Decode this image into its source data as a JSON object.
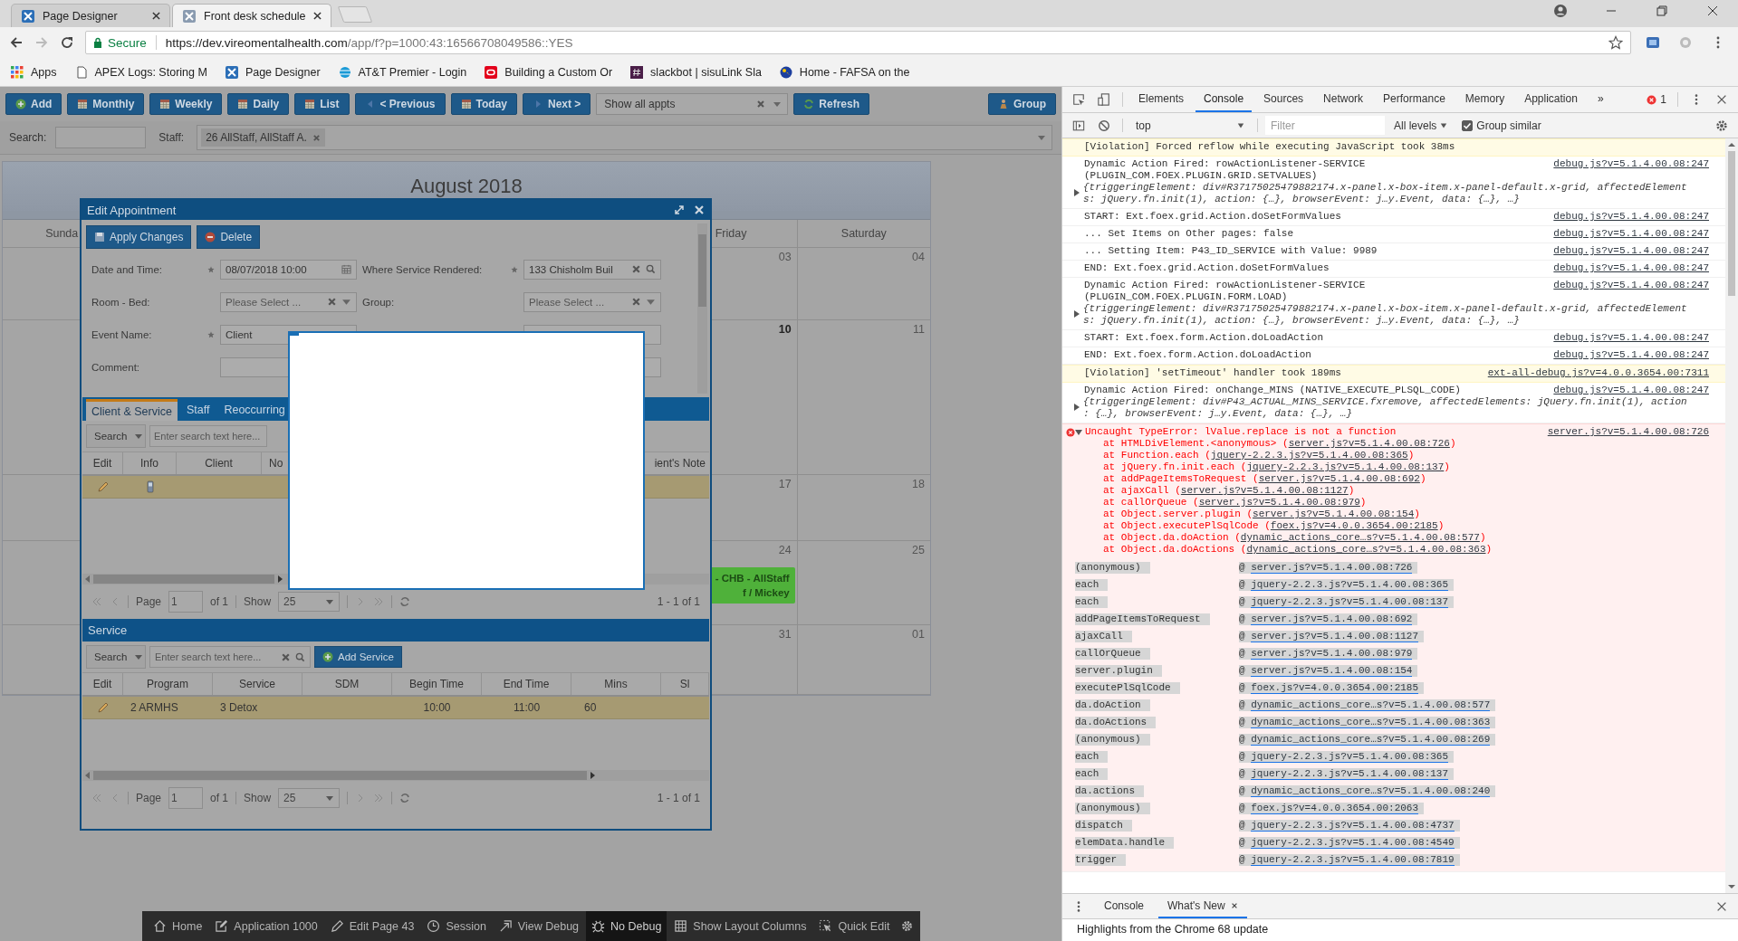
{
  "browser": {
    "tabs": [
      {
        "title": "Page Designer",
        "selected": false
      },
      {
        "title": "Front desk schedule",
        "selected": true
      }
    ],
    "address": {
      "secure_label": "Secure",
      "url_host": "https://dev.vireomentalhealth.com",
      "url_path": "/app/f?p=1000:43:16566708049586::YES"
    },
    "bookmarks": [
      {
        "label": "Apps",
        "kind": "apps"
      },
      {
        "label": "APEX Logs: Storing M",
        "kind": "page"
      },
      {
        "label": "Page Designer",
        "kind": "apex"
      },
      {
        "label": "AT&T Premier - Login",
        "kind": "globe"
      },
      {
        "label": "Building a Custom Or",
        "kind": "oracle"
      },
      {
        "label": "slackbot | sisuLink Sla",
        "kind": "hash"
      },
      {
        "label": "Home - FAFSA on the",
        "kind": "earth"
      }
    ]
  },
  "app": {
    "toolbar": [
      {
        "label": "Add",
        "kind": "add"
      },
      {
        "label": "Monthly",
        "kind": "calendar"
      },
      {
        "label": "Weekly",
        "kind": "calendar"
      },
      {
        "label": "Daily",
        "kind": "calendar"
      },
      {
        "label": "List",
        "kind": "calendar"
      },
      {
        "label": "< Previous",
        "kind": "prev"
      },
      {
        "label": "Today",
        "kind": "calendar"
      },
      {
        "label": "Next >",
        "kind": "next"
      }
    ],
    "filter_select": "Show all appts",
    "refresh": "Refresh",
    "group": "Group",
    "search_label": "Search:",
    "staff_label": "Staff:",
    "staff_chip": "26 AllStaff, AllStaff A.",
    "calendar": {
      "title": "August 2018",
      "weekdays": {
        "sunday": "Sunda",
        "friday": "Friday",
        "saturday": "Saturday"
      },
      "weeks": [
        {
          "friday": {
            "number": "03",
            "today": false
          },
          "saturday": {
            "number": "04",
            "today": false
          }
        },
        {
          "friday": {
            "number": "10",
            "today": true
          },
          "saturday": {
            "number": "11",
            "today": false
          }
        },
        {
          "friday": {
            "number": "17",
            "today": false
          },
          "saturday": {
            "number": "18",
            "today": false
          }
        },
        {
          "friday": {
            "number": "24",
            "today": false,
            "event": "- CHB - AllStaff\nf / Mickey"
          },
          "saturday": {
            "number": "25",
            "today": false
          }
        },
        {
          "friday": {
            "number": "31",
            "today": false
          },
          "saturday": {
            "number": "01",
            "today": false
          }
        }
      ]
    },
    "dialog": {
      "title": "Edit Appointment",
      "apply": "Apply Changes",
      "delete": "Delete",
      "form": [
        {
          "fields": [
            {
              "label": "Date and Time:",
              "required": true,
              "value": "08/07/2018 10:00",
              "kind": "date"
            },
            {
              "label": "Where Service Rendered:",
              "required": true,
              "value": "133 Chisholm Buil",
              "kind": "lookup"
            }
          ]
        },
        {
          "fields": [
            {
              "label": "Room - Bed:",
              "required": false,
              "placeholder": "Please Select ...",
              "kind": "select"
            },
            {
              "label": "Group:",
              "required": false,
              "placeholder": "Please Select ...",
              "kind": "select"
            }
          ]
        },
        {
          "fields": [
            {
              "label": "Event Name:",
              "required": true,
              "value": "Client",
              "kind": "text"
            },
            {
              "kind": "text"
            }
          ]
        },
        {
          "fields": [
            {
              "label": "Comment:",
              "required": false,
              "kind": "text"
            },
            {
              "kind": "text"
            }
          ]
        }
      ],
      "tabs": [
        {
          "label": "Client & Service",
          "selected": true
        },
        {
          "label": "Staff",
          "selected": false
        },
        {
          "label": "Reoccurring",
          "selected": false
        }
      ],
      "client_grid": {
        "search": "Search",
        "placeholder": "Enter search text here...",
        "columns": [
          "Edit",
          "Info",
          "Client",
          "No"
        ],
        "column_right": "ient's Note",
        "pager": {
          "page": "Page",
          "page_value": "1",
          "of": "of 1",
          "show": "Show",
          "show_value": "25",
          "count": "1 - 1 of 1"
        }
      },
      "service_title": "Service",
      "service_grid": {
        "search": "Search",
        "placeholder": "Enter search text here...",
        "add": "Add Service",
        "columns": [
          "Edit",
          "Program",
          "Service",
          "SDM",
          "Begin Time",
          "End Time",
          "Mins",
          "Sl"
        ],
        "row": {
          "program": "2 ARMHS",
          "service": "3 Detox",
          "begin": "10:00",
          "end": "11:00",
          "mins": "60"
        },
        "pager": {
          "page": "Page",
          "page_value": "1",
          "of": "of 1",
          "show": "Show",
          "show_value": "25",
          "count": "1 - 1 of 1"
        }
      }
    },
    "dev_bar": [
      {
        "label": "Home",
        "kind": "home",
        "selected": false
      },
      {
        "label": "Application 1000",
        "kind": "edit",
        "selected": false
      },
      {
        "label": "Edit Page 43",
        "kind": "pencil",
        "selected": false
      },
      {
        "label": "Session",
        "kind": "clock",
        "selected": false
      },
      {
        "label": "View Debug",
        "kind": "view",
        "selected": false
      },
      {
        "label": "No Debug",
        "kind": "bug",
        "selected": true
      },
      {
        "label": "Show Layout Columns",
        "kind": "grid",
        "selected": false
      },
      {
        "label": "Quick Edit",
        "kind": "cursor",
        "selected": false
      }
    ]
  },
  "devtools": {
    "tabs": [
      {
        "label": "Elements",
        "selected": false
      },
      {
        "label": "Console",
        "selected": true
      },
      {
        "label": "Sources",
        "selected": false
      },
      {
        "label": "Network",
        "selected": false
      },
      {
        "label": "Performance",
        "selected": false
      },
      {
        "label": "Memory",
        "selected": false
      },
      {
        "label": "Application",
        "selected": false
      }
    ],
    "more": "»",
    "error_count": "1",
    "context": "top",
    "filter_placeholder": "Filter",
    "levels": "All levels",
    "group_similar": {
      "label": "Group similar",
      "checked": true
    },
    "messages": [
      {
        "kind": "violation",
        "text": "[Violation] Forced reflow while executing JavaScript took 38ms"
      },
      {
        "kind": "log",
        "text": "Dynamic Action Fired: rowActionListener-SERVICE\n(PLUGIN_COM.FOEX.PLUGIN.GRID.SETVALUES)",
        "source": "debug.js?v=5.1.4.00.08:247",
        "object": "{triggeringElement: div#R37175025479882174.x-panel.x-box-item.x-panel-default.x-grid, affectedElement\ns: jQuery.fn.init(1), action: {…}, browserEvent: j…y.Event, data: {…}, …}"
      },
      {
        "kind": "log",
        "text": "START: Ext.foex.grid.Action.doSetFormValues",
        "source": "debug.js?v=5.1.4.00.08:247"
      },
      {
        "kind": "log",
        "text": "... Set Items on Other pages: false",
        "source": "debug.js?v=5.1.4.00.08:247"
      },
      {
        "kind": "log",
        "text": "... Setting Item: P43_ID_SERVICE with Value: 9989",
        "source": "debug.js?v=5.1.4.00.08:247"
      },
      {
        "kind": "log",
        "text": "END: Ext.foex.grid.Action.doSetFormValues",
        "source": "debug.js?v=5.1.4.00.08:247"
      },
      {
        "kind": "log",
        "text": "Dynamic Action Fired: rowActionListener-SERVICE\n(PLUGIN_COM.FOEX.PLUGIN.FORM.LOAD)",
        "source": "debug.js?v=5.1.4.00.08:247",
        "object": "{triggeringElement: div#R37175025479882174.x-panel.x-box-item.x-panel-default.x-grid, affectedElement\ns: jQuery.fn.init(1), action: {…}, browserEvent: j…y.Event, data: {…}, …}"
      },
      {
        "kind": "log",
        "text": "START: Ext.foex.form.Action.doLoadAction",
        "source": "debug.js?v=5.1.4.00.08:247"
      },
      {
        "kind": "log",
        "text": "END: Ext.foex.form.Action.doLoadAction",
        "source": "debug.js?v=5.1.4.00.08:247"
      },
      {
        "kind": "violation",
        "text": "[Violation] 'setTimeout' handler took 189ms",
        "source": "ext-all-debug.js?v=4.0.0.3654.00:7311"
      },
      {
        "kind": "log",
        "text": "Dynamic Action Fired: onChange_MINS (NATIVE_EXECUTE_PLSQL_CODE)",
        "source": "debug.js?v=5.1.4.00.08:247",
        "object": "{triggeringElement: div#P43_ACTUAL_MINS_SERVICE.fxremove, affectedElements: jQuery.fn.init(1), action\n: {…}, browserEvent: j…y.Event, data: {…}, …}"
      },
      {
        "kind": "error",
        "text": "Uncaught TypeError: lValue.replace is not a function",
        "source": "server.js?v=5.1.4.00.08:726",
        "expanded": true,
        "stack": [
          {
            "pre": "at HTMLDivElement.<anonymous> (",
            "link": "server.js?v=5.1.4.00.08:726",
            "post": ")"
          },
          {
            "pre": "at Function.each (",
            "link": "jquery-2.2.3.js?v=5.1.4.00.08:365",
            "post": ")"
          },
          {
            "pre": "at jQuery.fn.init.each (",
            "link": "jquery-2.2.3.js?v=5.1.4.00.08:137",
            "post": ")"
          },
          {
            "pre": "at addPageItemsToRequest (",
            "link": "server.js?v=5.1.4.00.08:692",
            "post": ")"
          },
          {
            "pre": "at ajaxCall (",
            "link": "server.js?v=5.1.4.00.08:1127",
            "post": ")"
          },
          {
            "pre": "at callOrQueue (",
            "link": "server.js?v=5.1.4.00.08:979",
            "post": ")"
          },
          {
            "pre": "at Object.server.plugin (",
            "link": "server.js?v=5.1.4.00.08:154",
            "post": ")"
          },
          {
            "pre": "at Object.executePlSqlCode (",
            "link": "foex.js?v=4.0.0.3654.00:2185",
            "post": ")"
          },
          {
            "pre": "at Object.da.doAction (",
            "link": "dynamic_actions_core…s?v=5.1.4.00.08:577",
            "post": ")"
          },
          {
            "pre": "at Object.da.doActions (",
            "link": "dynamic_actions_core…s?v=5.1.4.00.08:363",
            "post": ")"
          }
        ],
        "frames": [
          {
            "fn": "(anonymous)",
            "at": "@",
            "link": "server.js?v=5.1.4.00.08:726"
          },
          {
            "fn": "each",
            "at": "@",
            "link": "jquery-2.2.3.js?v=5.1.4.00.08:365"
          },
          {
            "fn": "each",
            "at": "@",
            "link": "jquery-2.2.3.js?v=5.1.4.00.08:137"
          },
          {
            "fn": "addPageItemsToRequest",
            "at": "@",
            "link": "server.js?v=5.1.4.00.08:692"
          },
          {
            "fn": "ajaxCall",
            "at": "@",
            "link": "server.js?v=5.1.4.00.08:1127"
          },
          {
            "fn": "callOrQueue",
            "at": "@",
            "link": "server.js?v=5.1.4.00.08:979"
          },
          {
            "fn": "server.plugin",
            "at": "@",
            "link": "server.js?v=5.1.4.00.08:154"
          },
          {
            "fn": "executePlSqlCode",
            "at": "@",
            "link": "foex.js?v=4.0.0.3654.00:2185"
          },
          {
            "fn": "da.doAction",
            "at": "@",
            "link": "dynamic_actions_core…s?v=5.1.4.00.08:577"
          },
          {
            "fn": "da.doActions",
            "at": "@",
            "link": "dynamic_actions_core…s?v=5.1.4.00.08:363"
          },
          {
            "fn": "(anonymous)",
            "at": "@",
            "link": "dynamic_actions_core…s?v=5.1.4.00.08:269"
          },
          {
            "fn": "each",
            "at": "@",
            "link": "jquery-2.2.3.js?v=5.1.4.00.08:365"
          },
          {
            "fn": "each",
            "at": "@",
            "link": "jquery-2.2.3.js?v=5.1.4.00.08:137"
          },
          {
            "fn": "da.actions",
            "at": "@",
            "link": "dynamic_actions_core…s?v=5.1.4.00.08:240"
          },
          {
            "fn": "(anonymous)",
            "at": "@",
            "link": "foex.js?v=4.0.0.3654.00:2063"
          },
          {
            "fn": "dispatch",
            "at": "@",
            "link": "jquery-2.2.3.js?v=5.1.4.00.08:4737"
          },
          {
            "fn": "elemData.handle",
            "at": "@",
            "link": "jquery-2.2.3.js?v=5.1.4.00.08:4549"
          },
          {
            "fn": "trigger",
            "at": "@",
            "link": "jquery-2.2.3.js?v=5.1.4.00.08:7819"
          }
        ]
      }
    ],
    "drawer_tabs": [
      {
        "label": "Console",
        "selected": false
      },
      {
        "label": "What's New",
        "selected": true
      }
    ],
    "whats_new": "Highlights from the Chrome 68 update"
  }
}
